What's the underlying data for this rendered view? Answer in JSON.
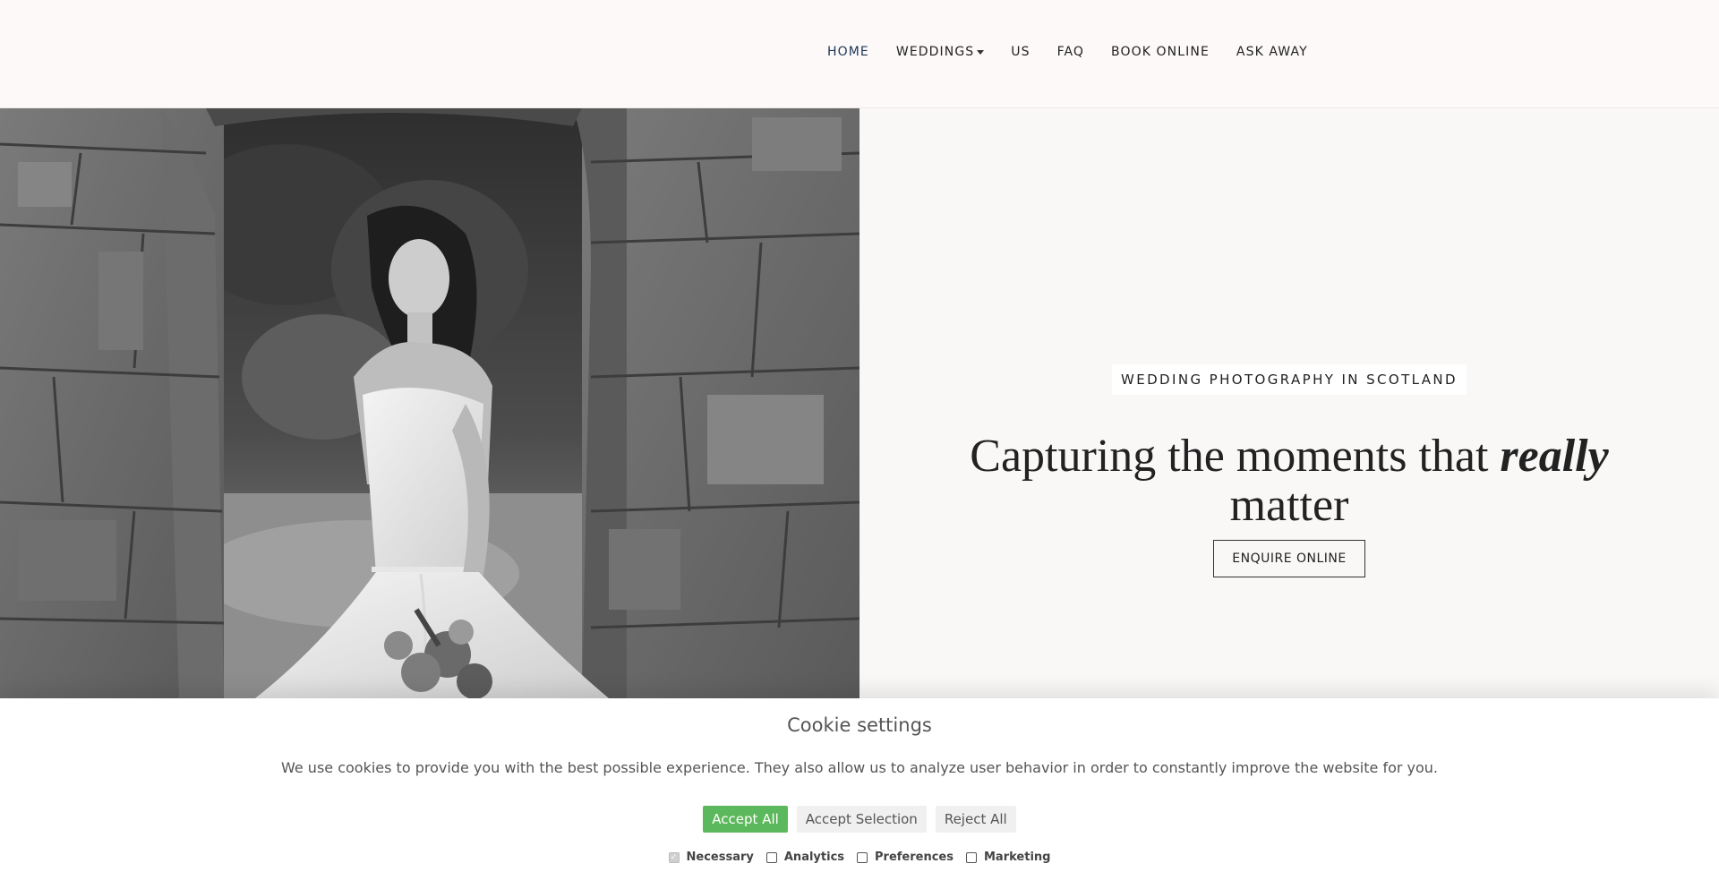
{
  "header": {
    "nav": [
      {
        "label": "HOME",
        "active": true
      },
      {
        "label": "WEDDINGS",
        "dropdown": true
      },
      {
        "label": "US"
      },
      {
        "label": "FAQ"
      },
      {
        "label": "BOOK ONLINE"
      },
      {
        "label": "ASK AWAY"
      }
    ]
  },
  "hero": {
    "kicker": "WEDDING PHOTOGRAPHY IN SCOTLAND",
    "headline_part1": "Capturing the moments that",
    "headline_emphasis": "really",
    "headline_part2": "matter",
    "button": "ENQUIRE ONLINE"
  },
  "cookie": {
    "title": "Cookie settings",
    "text": "We use cookies to provide you with the best possible experience. They also allow us to analyze user behavior in order to constantly improve the website for you.",
    "buttons": {
      "accept_all": "Accept All",
      "accept_selection": "Accept Selection",
      "reject_all": "Reject All"
    },
    "options": [
      {
        "label": "Necessary",
        "checked": true,
        "disabled": true
      },
      {
        "label": "Analytics",
        "checked": false
      },
      {
        "label": "Preferences",
        "checked": false
      },
      {
        "label": "Marketing",
        "checked": false
      }
    ]
  },
  "colors": {
    "accept_green": "#5cb85c",
    "background": "#fcf9f8",
    "active_nav": "#1d3557"
  }
}
